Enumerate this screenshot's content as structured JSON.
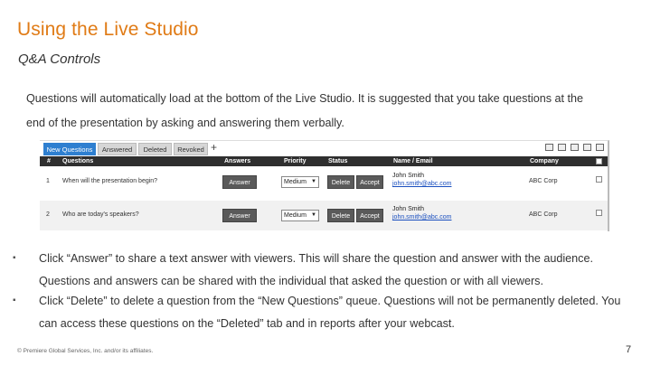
{
  "slide": {
    "title": "Using the Live Studio",
    "subtitle": "Q&A Controls",
    "intro": "Questions will automatically load at the bottom of the Live Studio. It is suggested that you take questions at the end of the presentation by asking and answering them verbally.",
    "bullets": [
      "Click “Answer” to share a text answer with viewers.  This will share the question and answer with the audience. Questions and answers can be shared with the individual that asked the question or with all viewers.",
      "Click “Delete” to delete a question from the “New Questions” queue.  Questions will not be permanently deleted. You can access these questions on the “Deleted” tab and in reports after your webcast."
    ],
    "bullet_glyph": "▪",
    "footer": "© Premiere Global Services, Inc. and/or its affiliates.",
    "page_number": "7"
  },
  "qa": {
    "tabs": [
      "New Questions",
      "Answered",
      "Deleted",
      "Revoked"
    ],
    "add_tab_glyph": "+",
    "columns": {
      "num": "#",
      "questions": "Questions",
      "answers": "Answers",
      "priority": "Priority",
      "status": "Status",
      "name_email": "Name / Email",
      "company": "Company"
    },
    "rows": [
      {
        "num": "1",
        "question": "When will the presentation begin?",
        "answer_label": "Answer",
        "priority": "Medium",
        "delete_label": "Delete",
        "accept_label": "Accept",
        "name": "John Smith",
        "email": "john.smith@abc.com",
        "company": "ABC Corp"
      },
      {
        "num": "2",
        "question": "Who are today's speakers?",
        "answer_label": "Answer",
        "priority": "Medium",
        "delete_label": "Delete",
        "accept_label": "Accept",
        "name": "John Smith",
        "email": "john.smith@abc.com",
        "company": "ABC Corp"
      }
    ],
    "toolbar_icons": [
      "print-icon",
      "popout-icon",
      "sort-icon",
      "email-icon",
      "export-icon"
    ]
  },
  "colors": {
    "title": "#e07b16",
    "active_tab": "#2e7fd0",
    "header_bar": "#2f2f2f",
    "button": "#5a5a5a"
  }
}
